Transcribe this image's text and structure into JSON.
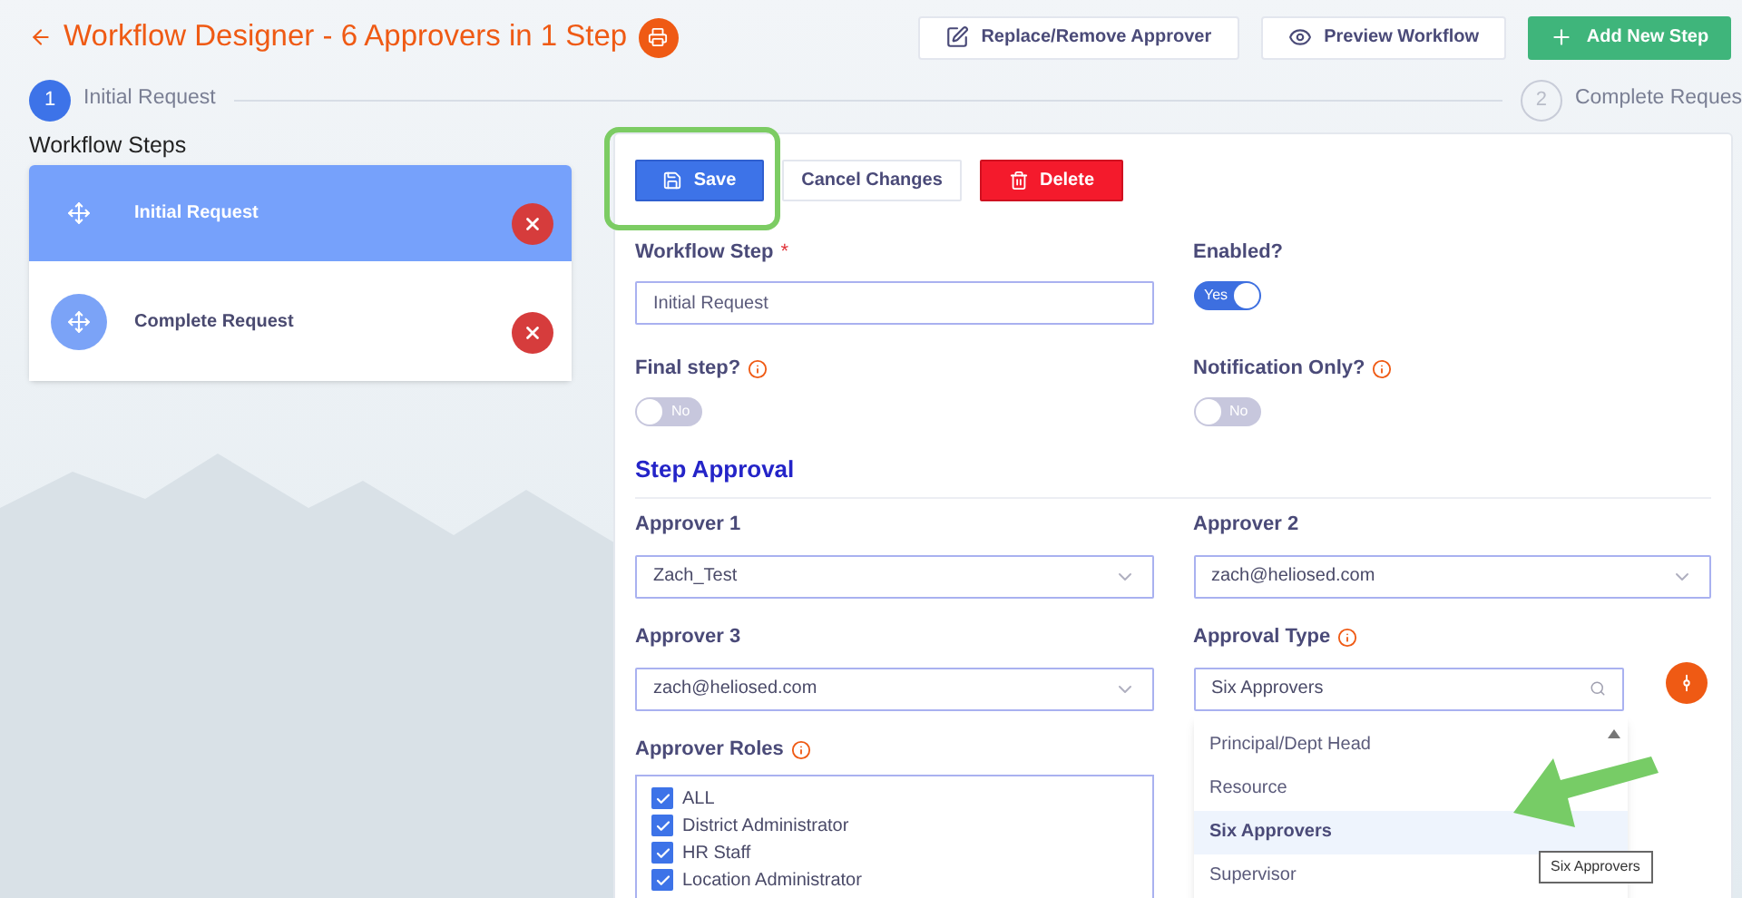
{
  "header": {
    "title": "Workflow Designer - 6 Approvers in 1 Step",
    "buttons": [
      {
        "label": "Replace/Remove Approver",
        "kind": "edit"
      },
      {
        "label": "Preview Workflow",
        "kind": "preview"
      },
      {
        "label": "Add New Step",
        "kind": "add"
      }
    ]
  },
  "stepper": [
    {
      "number": "1",
      "label": "Initial Request",
      "selected": true
    },
    {
      "number": "2",
      "label": "Complete Reques",
      "selected": false
    }
  ],
  "sidebar": {
    "title": "Workflow Steps",
    "items": [
      {
        "label": "Initial Request",
        "selected": true
      },
      {
        "label": "Complete Request",
        "selected": false
      }
    ]
  },
  "form": {
    "actions": [
      {
        "label": "Save",
        "kind": "save"
      },
      {
        "label": "Cancel Changes",
        "kind": "cancel"
      },
      {
        "label": "Delete",
        "kind": "delete"
      }
    ],
    "fields": [
      {
        "kind": "text",
        "label": "Workflow Step",
        "required_mark": "*",
        "info": false,
        "value": "Initial Request"
      },
      {
        "kind": "toggle",
        "label": "Enabled?",
        "info": false,
        "on": true,
        "text": "Yes"
      },
      {
        "kind": "toggle",
        "label": "Final step?",
        "info": true,
        "on": false,
        "text": "No"
      },
      {
        "kind": "toggle",
        "label": "Notification Only?",
        "info": true,
        "on": false,
        "text": "No"
      }
    ],
    "section_title": "Step Approval",
    "approvers": [
      {
        "kind": "select",
        "label": "Approver 1",
        "info": false,
        "value": "Zach_Test"
      },
      {
        "kind": "select",
        "label": "Approver 2",
        "info": false,
        "value": "zach@heliosed.com"
      },
      {
        "kind": "select",
        "label": "Approver 3",
        "info": false,
        "value": "zach@heliosed.com"
      },
      {
        "kind": "search",
        "label": "Approval Type",
        "info": true,
        "value": "Six Approvers"
      }
    ],
    "approver_roles": {
      "label": "Approver Roles",
      "info": true,
      "options": [
        {
          "label": "ALL",
          "checked": true
        },
        {
          "label": "District Administrator",
          "checked": true
        },
        {
          "label": "HR Staff",
          "checked": true
        },
        {
          "label": "Location Administrator",
          "checked": true
        }
      ]
    },
    "dropdown": {
      "options": [
        {
          "label": "Principal/Dept Head",
          "selected": false
        },
        {
          "label": "Resource",
          "selected": false
        },
        {
          "label": "Six Approvers",
          "selected": true
        },
        {
          "label": "Supervisor",
          "selected": false
        }
      ],
      "tooltip": "Six Approvers"
    }
  }
}
